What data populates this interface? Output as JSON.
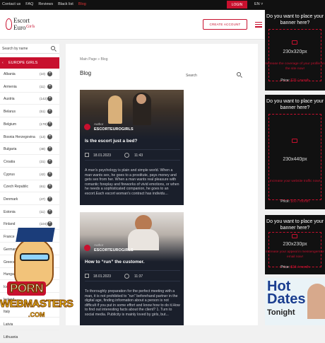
{
  "topbar": {
    "links": [
      "Contact us",
      "FAQ",
      "Reviews",
      "Black list",
      "Blog"
    ],
    "active_link": "Blog",
    "login_label": "LOGIN",
    "language": "EN ˅"
  },
  "header": {
    "logo_line1": "Escort",
    "logo_line2": "Euro",
    "logo_tagline": "Girls",
    "create_account_label": "CREATE ACCOUNT"
  },
  "sidebar": {
    "search_placeholder": "Search by name",
    "category_label": "EUROPE GIRLS",
    "countries": [
      {
        "name": "Albania",
        "count": "(10)"
      },
      {
        "name": "Armenia",
        "count": "(11)"
      },
      {
        "name": "Austria",
        "count": "(142)"
      },
      {
        "name": "Belarus",
        "count": "(51)"
      },
      {
        "name": "Belgium",
        "count": "(178)"
      },
      {
        "name": "Bosnia Herzegovina",
        "count": "(13)"
      },
      {
        "name": "Bulgaria",
        "count": "(48)"
      },
      {
        "name": "Croatia",
        "count": "(31)"
      },
      {
        "name": "Cyprus",
        "count": "(42)"
      },
      {
        "name": "Czech Republic",
        "count": "(61)"
      },
      {
        "name": "Denmark",
        "count": "(47)"
      },
      {
        "name": "Estonia",
        "count": "(11)"
      },
      {
        "name": "Finland",
        "count": "(104)"
      },
      {
        "name": "France",
        "count": "(427)"
      },
      {
        "name": "Germany",
        "count": "(1364)"
      },
      {
        "name": "Greece",
        "count": ""
      },
      {
        "name": "Hungary",
        "count": ""
      },
      {
        "name": "Iceland",
        "count": ""
      },
      {
        "name": "Ireland",
        "count": ""
      },
      {
        "name": "Italy",
        "count": ""
      },
      {
        "name": "Latvia",
        "count": ""
      },
      {
        "name": "Lithuania",
        "count": ""
      }
    ]
  },
  "main": {
    "breadcrumb_home": "Main Page",
    "breadcrumb_sep": "»",
    "breadcrumb_current": "Blog",
    "title": "Blog",
    "search_placeholder": "Search",
    "posts": [
      {
        "author_label": "Author",
        "author": "ESCORTEUROGIRLS",
        "title": "Is the escort just a bed?",
        "date": "18.01.2023",
        "time": "11:43",
        "excerpt": "A man's psychology is plain and simple world. When a man wants sex, he goes to a prostitute, pays money and gets sex from her. When a man wants real pleasure with romantic foreplay and fireworks of vivid emotions, or when he needs a sophisticated companion, he goes to an escort.Each escort woman's contract has individu..."
      },
      {
        "author_label": "Author",
        "author": "ESCORTEUROGIRLS",
        "title": "How to “run” the customer.",
        "date": "18.01.2023",
        "time": "11:37",
        "excerpt": "To thoroughly preparation for the perfect meeting with a man, it is not prohibited to “run” beforehand partner in the digital age, finding information about a person is not difficult if you put in some effort and know how to do it.How to find out interesting facts about the client? 1. Turn to social media. Publicity is mainly loved by girls, but..."
      }
    ]
  },
  "ads": [
    {
      "question": "Do you want to place your banner here?",
      "size": "230x320px",
      "promo": "Increase the coverage of your profile on the site now!",
      "price_label": "Price:",
      "price": "$25 / month"
    },
    {
      "question": "Do you want to place your banner here?",
      "size": "230x440px",
      "promo": "Increase your website traffic now!",
      "price_label": "Price:",
      "price": "$50 / month"
    },
    {
      "question": "Do you want to place your banner here?",
      "size": "230x230px",
      "promo": "Increase your appeal in messengers or email now!",
      "price_label": "Price:",
      "price": "$15 / month"
    }
  ],
  "hotdates": {
    "line1": "Hot",
    "line2": "Dates",
    "line3": "Tonight"
  },
  "watermark": {
    "line1": "PORN",
    "line2": "WEBMASTERS",
    "line3": ".COM"
  },
  "colors": {
    "accent": "#c8102e",
    "card_bg": "#1a1f2b",
    "ad_bg": "#111111"
  }
}
